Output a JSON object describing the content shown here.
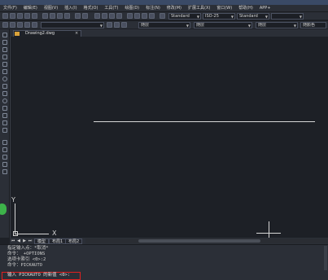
{
  "window": {
    "title": ""
  },
  "menu": [
    {
      "label": "文件(F)"
    },
    {
      "label": "编辑(E)"
    },
    {
      "label": "视图(V)"
    },
    {
      "label": "插入(I)"
    },
    {
      "label": "格式(O)"
    },
    {
      "label": "工具(T)"
    },
    {
      "label": "绘图(D)"
    },
    {
      "label": "标注(N)"
    },
    {
      "label": "修改(M)"
    },
    {
      "label": "扩展工具(X)"
    },
    {
      "label": "窗口(W)"
    },
    {
      "label": "帮助(H)"
    },
    {
      "label": "APP+"
    }
  ],
  "toolbar": {
    "text_style": "Standard",
    "dim_style": "ISO-25",
    "table_style": "Standard",
    "layer": "",
    "color": "随层",
    "linetype": "随层",
    "lineweight": "随层",
    "plot_style": "随颜色"
  },
  "document": {
    "tab_label": "Drawing2.dwg",
    "close_glyph": "×"
  },
  "ucs": {
    "x_label": "X",
    "y_label": "Y"
  },
  "layout_tabs": [
    {
      "label": "模型"
    },
    {
      "label": "布局1"
    },
    {
      "label": "布局2"
    }
  ],
  "command_history": [
    "指定输入点：*取消*",
    "命令：_+OPTIONS",
    "选项卡索引 <0>:2",
    "命令：PICKAUTO"
  ],
  "command_prompt": "输入 PICKAUTO 的新值 <0>:",
  "colors": {
    "background": "#1d2026",
    "panel": "#2b2f37",
    "highlight_border": "#e02020",
    "accent_green": "#3db34a"
  }
}
